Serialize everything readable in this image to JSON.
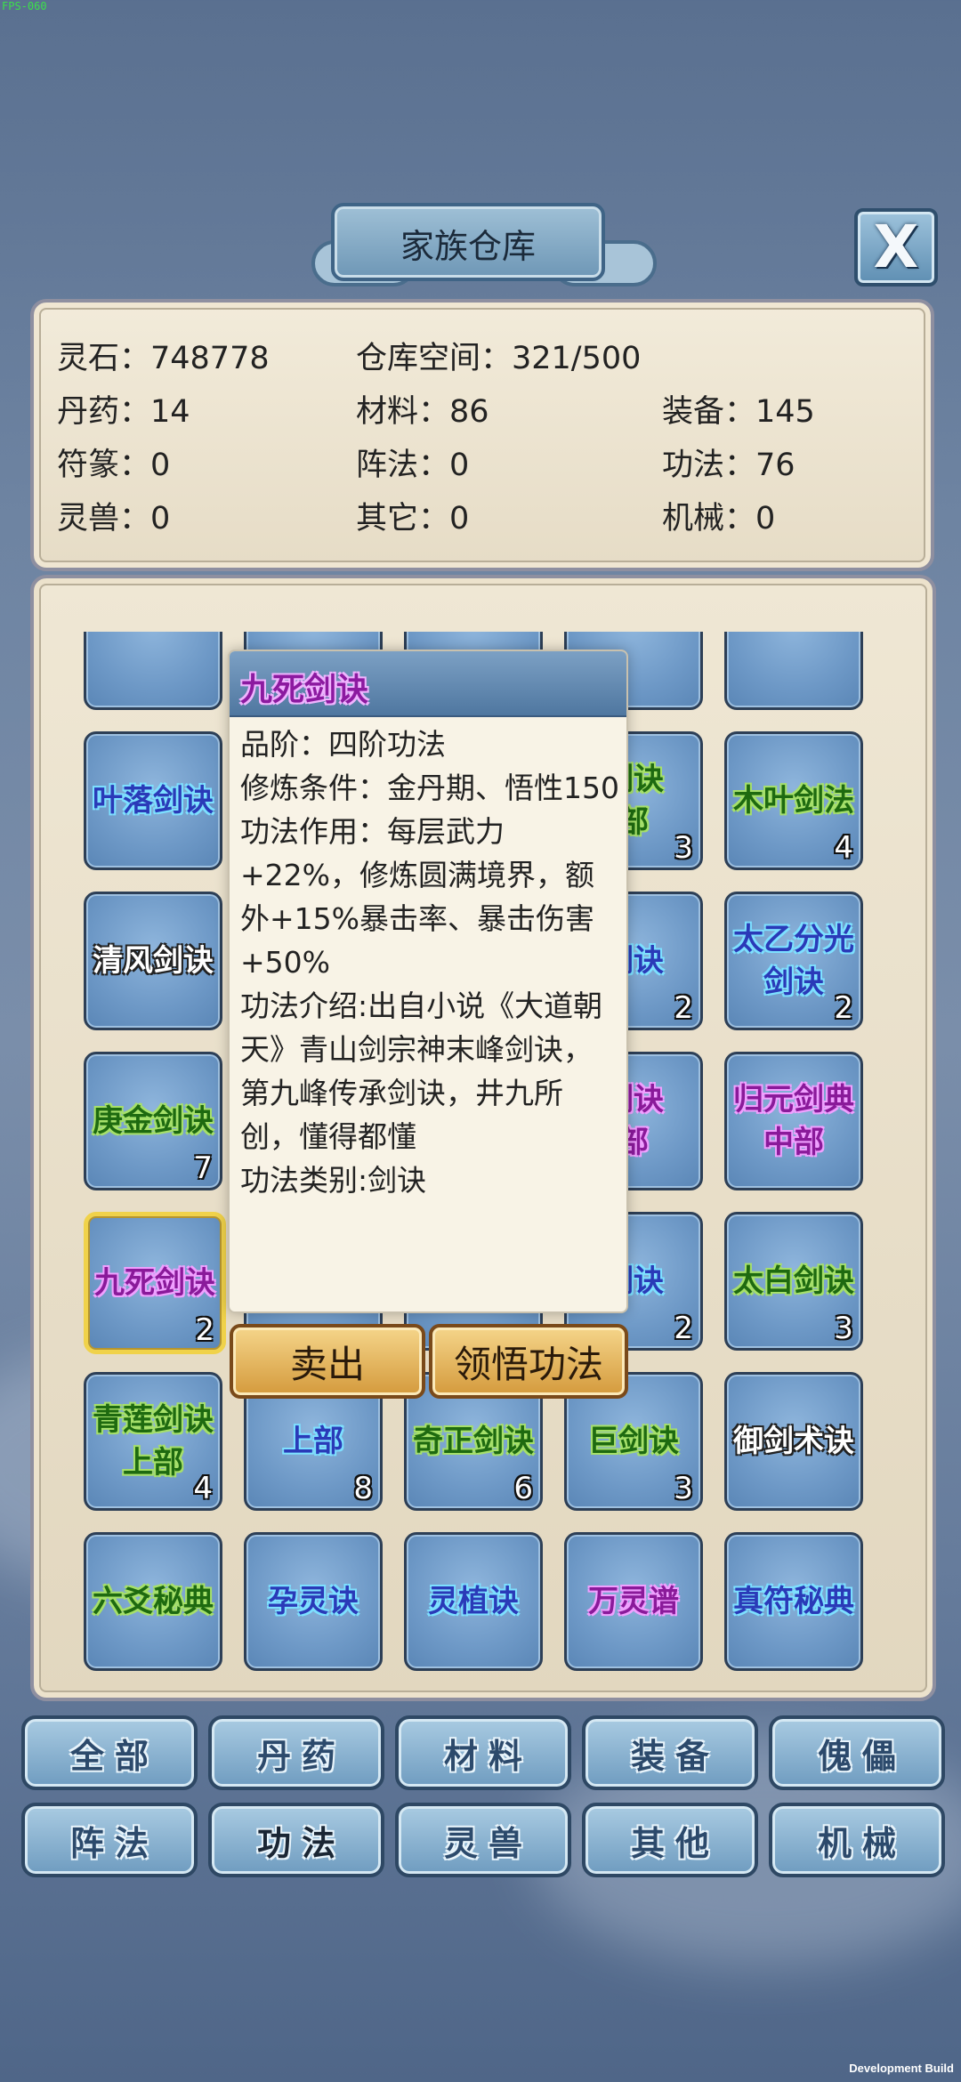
{
  "debug": {
    "fps": "FPS-060",
    "build": "Development Build"
  },
  "header": {
    "title": "家族仓库",
    "close_label": "X"
  },
  "stats": {
    "spirit_stone": "灵石：748778",
    "capacity": "仓库空间：321/500",
    "pills": "丹药：14",
    "materials": "材料：86",
    "equipment": "装备：145",
    "talismans": "符篆：0",
    "formations": "阵法：0",
    "techniques": "功法：76",
    "beasts": "灵兽：0",
    "others": "其它：0",
    "machinery": "机械：0"
  },
  "grid": {
    "rows": [
      [
        {
          "name": "",
          "count": "",
          "quality": "blue"
        },
        {
          "name": "",
          "count": "",
          "quality": "blue"
        },
        {
          "name": "",
          "count": "",
          "quality": "blue"
        },
        {
          "name": "",
          "count": "",
          "quality": "blue"
        },
        {
          "name": "",
          "count": "",
          "quality": "blue"
        }
      ],
      [
        {
          "name": "叶落剑诀",
          "count": "",
          "quality": "blue"
        },
        {
          "name": "",
          "count": "",
          "quality": "blue"
        },
        {
          "name": "",
          "count": "",
          "quality": "blue"
        },
        {
          "name": "剑诀\n部",
          "count": "3",
          "quality": "green"
        },
        {
          "name": "木叶剑法",
          "count": "4",
          "quality": "green"
        }
      ],
      [
        {
          "name": "清风剑诀",
          "count": "",
          "quality": "white"
        },
        {
          "name": "",
          "count": "",
          "quality": "blue"
        },
        {
          "name": "",
          "count": "",
          "quality": "blue"
        },
        {
          "name": "剑诀",
          "count": "2",
          "quality": "blue"
        },
        {
          "name": "太乙分光\n剑诀",
          "count": "2",
          "quality": "blue"
        }
      ],
      [
        {
          "name": "庚金剑诀",
          "count": "7",
          "quality": "green"
        },
        {
          "name": "",
          "count": "",
          "quality": "blue"
        },
        {
          "name": "",
          "count": "",
          "quality": "blue"
        },
        {
          "name": "剑诀\n部",
          "count": "",
          "quality": "purple"
        },
        {
          "name": "归元剑典\n中部",
          "count": "",
          "quality": "purple"
        }
      ],
      [
        {
          "name": "九死剑诀",
          "count": "2",
          "quality": "purple",
          "selected": true
        },
        {
          "name": "",
          "count": "",
          "quality": "blue"
        },
        {
          "name": "",
          "count": "",
          "quality": "blue"
        },
        {
          "name": "剑诀",
          "count": "2",
          "quality": "blue"
        },
        {
          "name": "太白剑诀",
          "count": "3",
          "quality": "green"
        }
      ],
      [
        {
          "name": "青莲剑诀\n上部",
          "count": "4",
          "quality": "green"
        },
        {
          "name": "上部",
          "count": "8",
          "quality": "blue"
        },
        {
          "name": "奇正剑诀",
          "count": "6",
          "quality": "green"
        },
        {
          "name": "巨剑诀",
          "count": "3",
          "quality": "green"
        },
        {
          "name": "御剑术诀",
          "count": "",
          "quality": "white"
        }
      ],
      [
        {
          "name": "六爻秘典",
          "count": "",
          "quality": "green"
        },
        {
          "name": "孕灵诀",
          "count": "",
          "quality": "blue"
        },
        {
          "name": "灵植诀",
          "count": "",
          "quality": "blue"
        },
        {
          "name": "万灵谱",
          "count": "",
          "quality": "purple"
        },
        {
          "name": "真符秘典",
          "count": "",
          "quality": "blue"
        }
      ]
    ]
  },
  "tooltip": {
    "title": "九死剑诀",
    "rank": "品阶：四阶功法",
    "requirement": "修炼条件：金丹期、悟性150",
    "effect": "功法作用：每层武力+22%，修炼圆满境界，额外+15%暴击率、暴击伤害+50%",
    "intro": "功法介绍:出自小说《大道朝天》青山剑宗神末峰剑诀，第九峰传承剑诀，井九所创，懂得都懂",
    "category": "功法类别:剑诀",
    "sell_label": "卖出",
    "learn_label": "领悟功法"
  },
  "tabs": [
    {
      "label": "全部"
    },
    {
      "label": "丹药"
    },
    {
      "label": "材料"
    },
    {
      "label": "装备"
    },
    {
      "label": "傀儡"
    },
    {
      "label": "阵法"
    },
    {
      "label": "功法",
      "active": true
    },
    {
      "label": "灵兽"
    },
    {
      "label": "其他"
    },
    {
      "label": "机械"
    }
  ],
  "colors": {
    "quality_green": "#1e6a10",
    "quality_blue": "#2a3ab8",
    "quality_purple": "#8a1a9a",
    "selected_border": "#f0d24a"
  }
}
